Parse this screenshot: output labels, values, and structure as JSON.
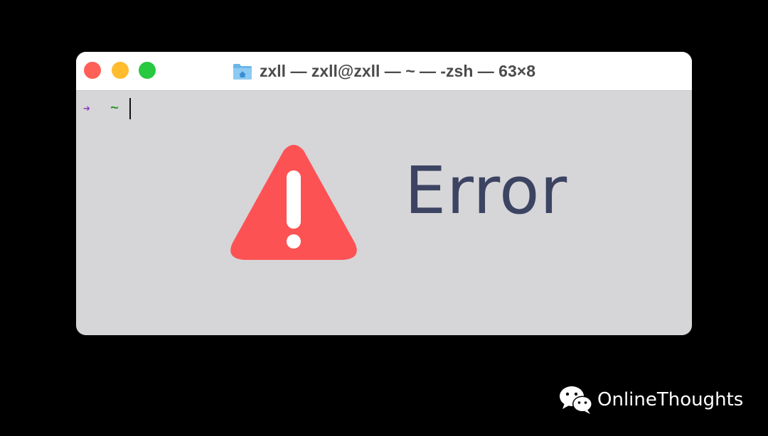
{
  "window": {
    "title": "zxll — zxll@zxll — ~ — -zsh — 63×8",
    "folder_icon": "home-folder-icon",
    "traffic_lights": {
      "close": "#fe5f57",
      "minimize": "#febc2e",
      "maximize": "#28c840"
    }
  },
  "terminal": {
    "prompt_arrow": "➜",
    "prompt_dir": "~",
    "arrow_color": "#8a3dc0",
    "dir_color": "#2f9a2f",
    "background": "#d6d5d8"
  },
  "error": {
    "icon": "warning-triangle-icon",
    "icon_color": "#fd5254",
    "text": "Error",
    "text_color": "#3c4462"
  },
  "watermark": {
    "icon": "wechat-icon",
    "text": "OnlineThoughts"
  }
}
